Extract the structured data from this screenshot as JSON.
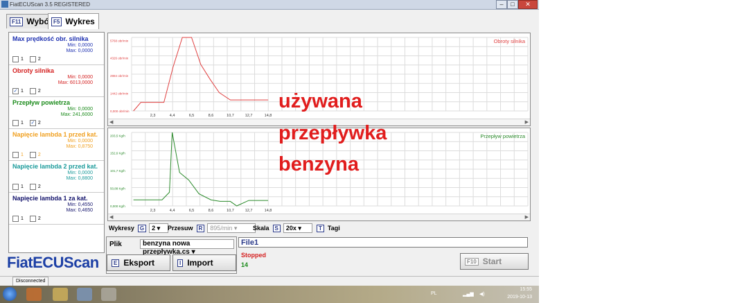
{
  "window": {
    "title": "FiatECUScan 3.5 REGISTERED",
    "btn_min": "–",
    "btn_max": "□",
    "btn_close": "✕"
  },
  "tabs": [
    {
      "key": "F11",
      "label": "Wybór"
    },
    {
      "key": "F5",
      "label": "Wykres"
    }
  ],
  "params": [
    {
      "name": "Max prędkość obr. silnika",
      "color": "#1c2fb0",
      "min": "Min: 0,0000",
      "max": "Max: 0,0000",
      "c1": "",
      "c2": ""
    },
    {
      "name": "Obroty silnika",
      "color": "#d42020",
      "min": "Min: 0,0000",
      "max": "Max: 6013,0000",
      "c1": "✓",
      "c2": ""
    },
    {
      "name": "Przepływ powietrza",
      "color": "#1a8a1a",
      "min": "Min: 0,0000",
      "max": "Max: 241,6000",
      "c1": "",
      "c2": "✓"
    },
    {
      "name": "Napięcie lambda 1 przed kat.",
      "color": "#f0a020",
      "min": "Min: 0,0000",
      "max": "Max: 0,8750",
      "c1": "",
      "c2": ""
    },
    {
      "name": "Napięcie lambda 2 przed kat.",
      "color": "#1a9a9a",
      "min": "Min: 0,0000",
      "max": "Max: 0,8800",
      "c1": "",
      "c2": ""
    },
    {
      "name": "Napięcie lambda 1 za kat.",
      "color": "#10106a",
      "min": "Min: 0,4550",
      "max": "Max: 0,4650",
      "c1": "",
      "c2": ""
    }
  ],
  "check_labels": {
    "one": "1",
    "two": "2"
  },
  "logo": "FiatECUScan",
  "chart_data": [
    {
      "type": "line",
      "title": "Obroty silnika",
      "color": "#e04040",
      "x_ticks": [
        "2,3",
        "4,4",
        "6,5",
        "8,6",
        "10,7",
        "12,7",
        "14,8"
      ],
      "y_ticks": [
        "0,000 obr/min",
        "1442 obr/min",
        "2884 obr/min",
        "4326 obr/min",
        "5768 obr/min"
      ],
      "ylim": [
        0,
        6013
      ],
      "x": [
        0.2,
        1.0,
        2.3,
        3.5,
        4.5,
        5.5,
        6.5,
        7.5,
        8.5,
        9.5,
        10.7,
        12.7,
        14.8
      ],
      "y": [
        0,
        700,
        700,
        700,
        3600,
        6013,
        6013,
        3800,
        2600,
        1500,
        900,
        900,
        900
      ]
    },
    {
      "type": "line",
      "title": "Przepływ powietrza",
      "color": "#2a8a2a",
      "x_ticks": [
        "2,3",
        "4,4",
        "6,5",
        "8,6",
        "10,7",
        "12,7",
        "14,8"
      ],
      "y_ticks": [
        "0,000 Kg/h",
        "50,88 Kg/h",
        "101,7 Kg/h",
        "152,6 Kg/h",
        "203,5 Kg/h"
      ],
      "ylim": [
        0,
        241.6
      ],
      "x": [
        0.2,
        3.3,
        4.1,
        4.4,
        5.2,
        6.2,
        7.3,
        8.6,
        9.6,
        10.7,
        11.4,
        12.7,
        14.8
      ],
      "y": [
        20,
        20,
        45,
        241.6,
        110,
        85,
        40,
        20,
        15,
        15,
        0,
        18,
        18
      ]
    }
  ],
  "overlay_lines": [
    "używana",
    "przepływka",
    "benzyna"
  ],
  "controls": {
    "wykresy_label": "Wykresy",
    "wykresy_key": "G",
    "wykresy_value": "2",
    "przesuw_label": "Przesuw",
    "przesuw_key": "R",
    "przesuw_value": "895/min",
    "skala_label": "Skala",
    "skala_key": "S",
    "skala_value": "20x",
    "tagi_key": "T",
    "tagi_label": "Tagi"
  },
  "file": {
    "label": "Plik",
    "value": "benzyna nowa przepływka.cs",
    "eksport_key": "E",
    "eksport_label": "Eksport",
    "import_key": "I",
    "import_label": "Import"
  },
  "status": {
    "file_name": "File1",
    "state": "Stopped",
    "count": "14",
    "start_key": "F10",
    "start_label": "Start"
  },
  "statusbar": {
    "text": "Disconnected"
  },
  "taskbar": {
    "lang": "PL",
    "time": "15:55",
    "date": "2019-10-13"
  }
}
